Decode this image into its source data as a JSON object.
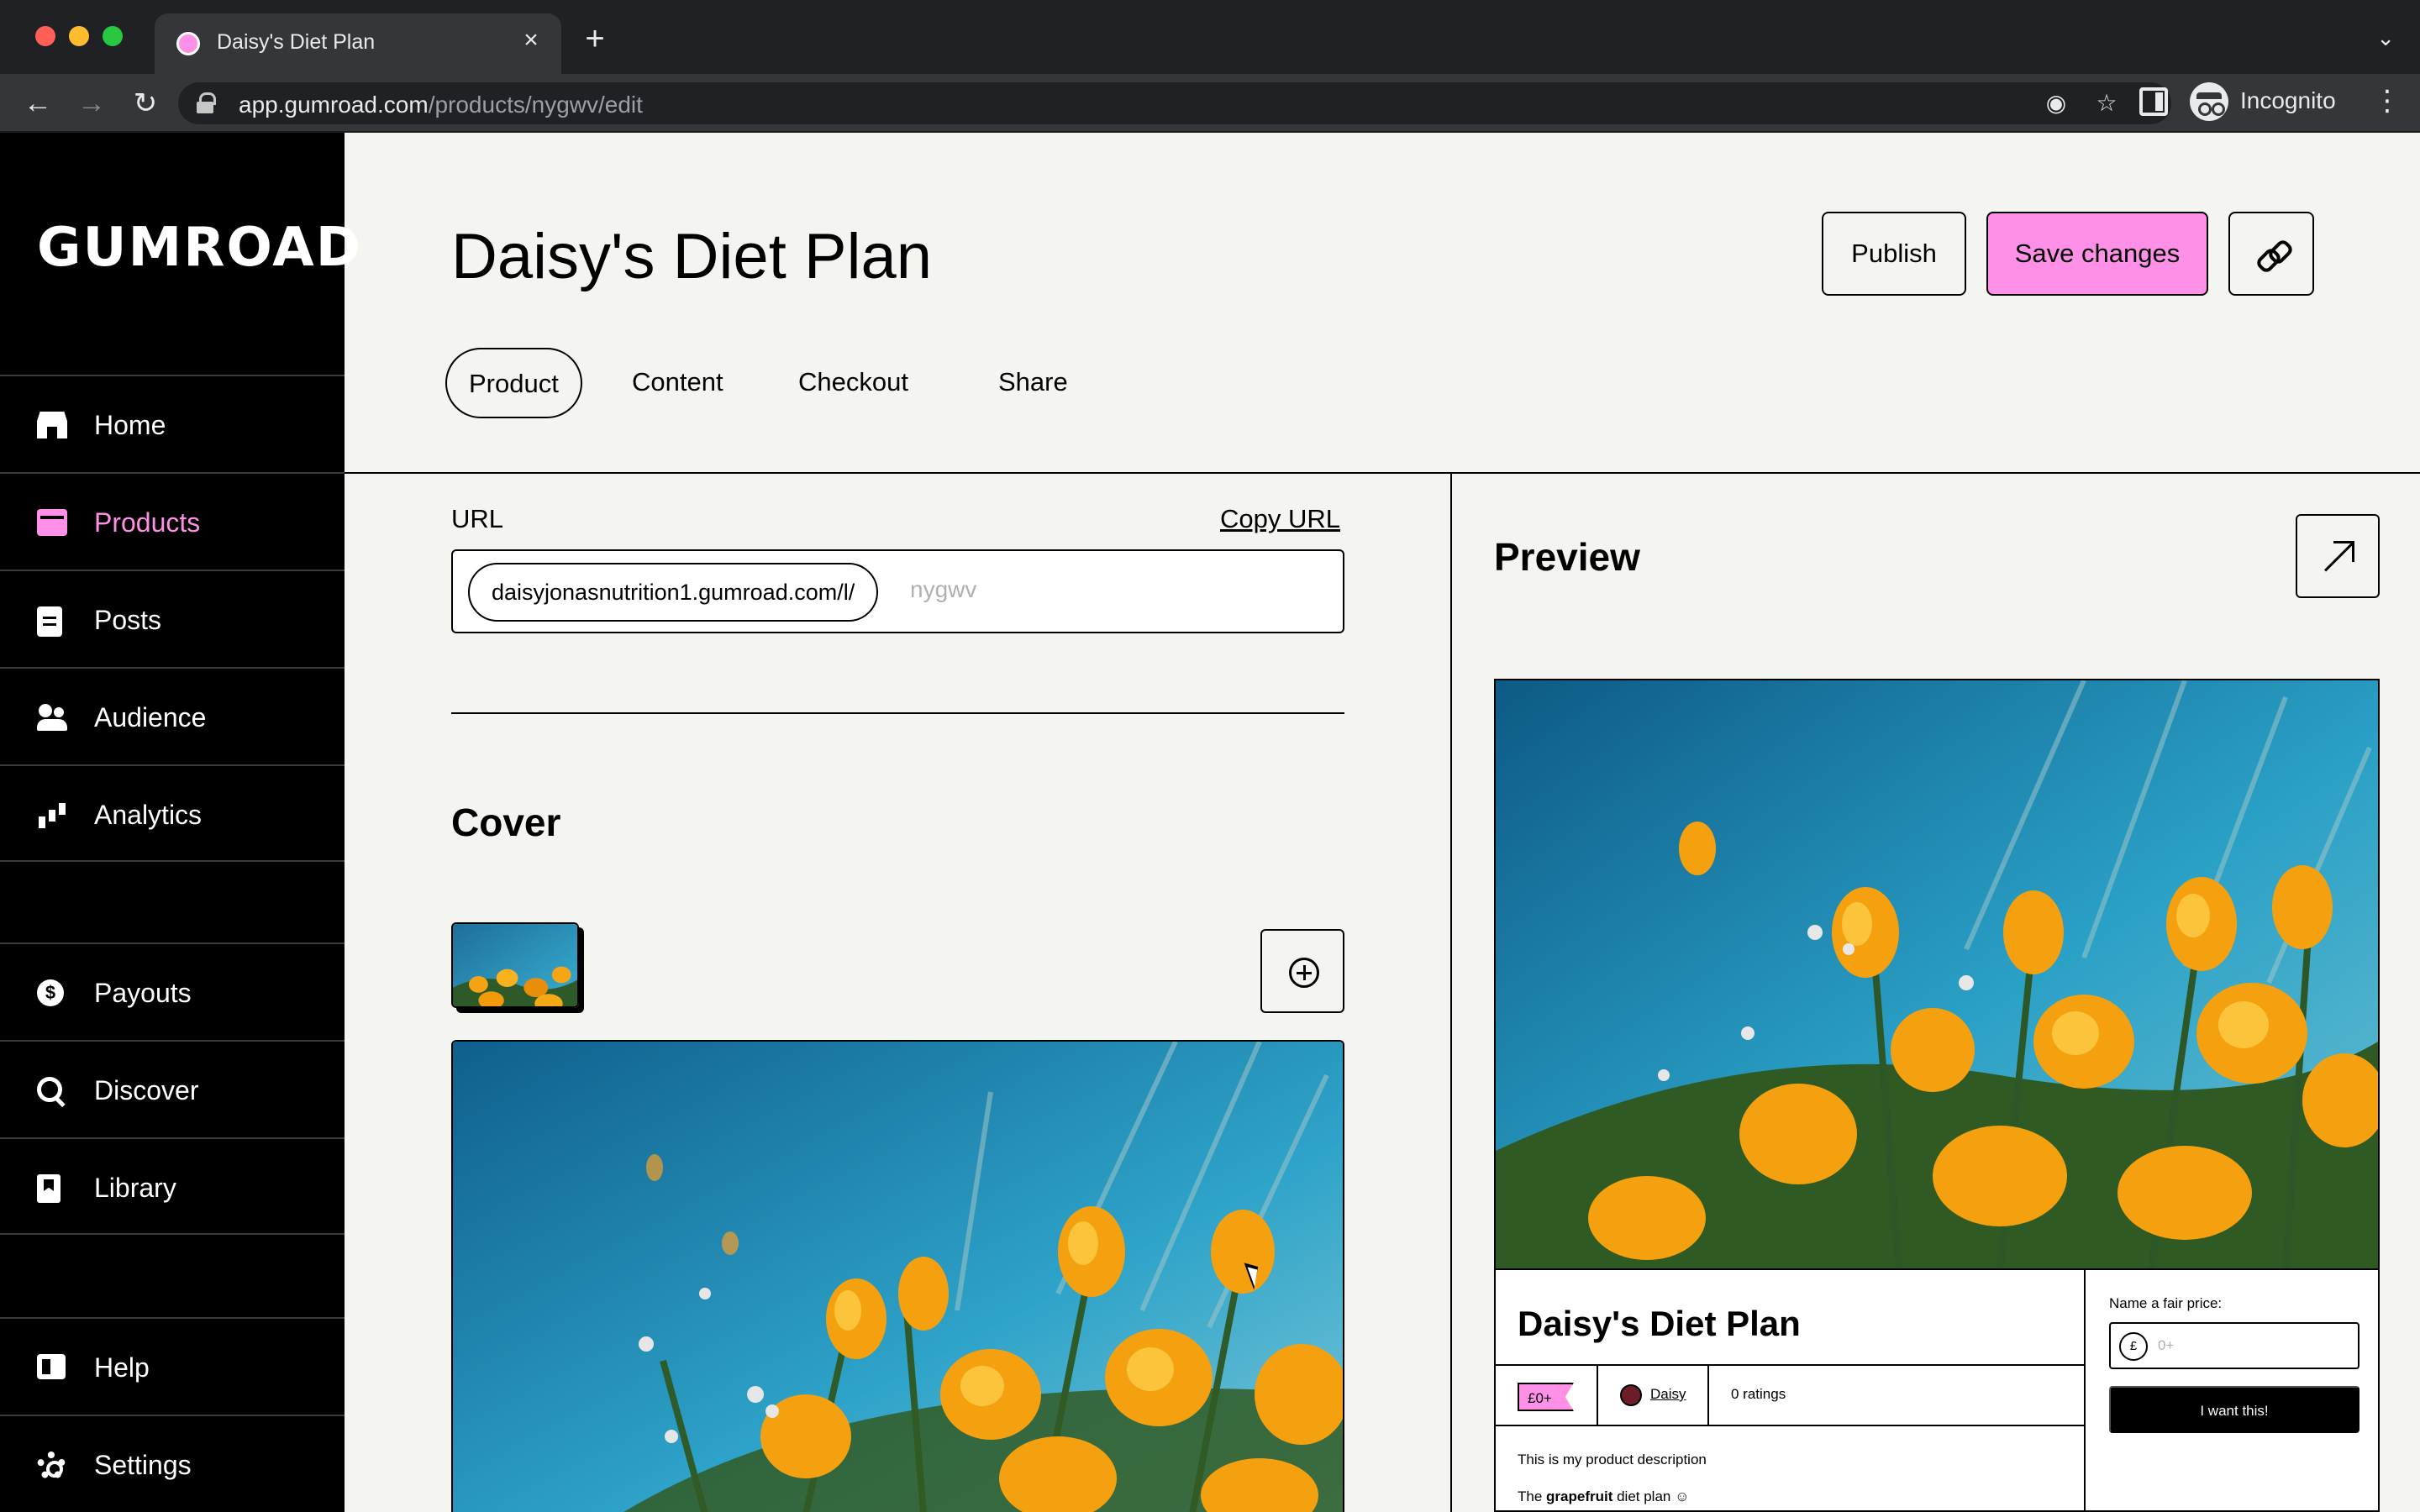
{
  "browser": {
    "tab_title": "Daisy's Diet Plan",
    "url_host": "app.gumroad.com",
    "url_path": "/products/nygwv/edit",
    "profile_label": "Incognito"
  },
  "sidebar": {
    "logo": "GUMROAD",
    "items": [
      {
        "label": "Home",
        "icon": "home-icon"
      },
      {
        "label": "Products",
        "icon": "products-icon",
        "active": true
      },
      {
        "label": "Posts",
        "icon": "posts-icon"
      },
      {
        "label": "Audience",
        "icon": "audience-icon"
      },
      {
        "label": "Analytics",
        "icon": "analytics-icon"
      },
      {
        "label": "Payouts",
        "icon": "payouts-icon"
      },
      {
        "label": "Discover",
        "icon": "discover-icon"
      },
      {
        "label": "Library",
        "icon": "library-icon"
      },
      {
        "label": "Help",
        "icon": "help-icon"
      },
      {
        "label": "Settings",
        "icon": "settings-icon"
      }
    ],
    "accent_color": "#ff90e8"
  },
  "header": {
    "title": "Daisy's Diet Plan",
    "publish_label": "Publish",
    "save_label": "Save changes"
  },
  "tabs": [
    {
      "label": "Product",
      "selected": true
    },
    {
      "label": "Content"
    },
    {
      "label": "Checkout"
    },
    {
      "label": "Share"
    }
  ],
  "editor": {
    "url_label": "URL",
    "copy_url_label": "Copy URL",
    "url_prefix": "daisyjonasnutrition1.gumroad.com/l/",
    "url_slug_placeholder": "nygwv",
    "cover_heading": "Cover"
  },
  "preview": {
    "heading": "Preview",
    "product_title": "Daisy's Diet Plan",
    "price_badge": "£0+",
    "creator": "Daisy",
    "ratings": "0 ratings",
    "description": "This is my product description",
    "desc_prefix": "The ",
    "desc_bold": "grapefruit",
    "desc_suffix": " diet plan ☺",
    "fair_price_label": "Name a fair price:",
    "currency_symbol": "£",
    "price_placeholder": "0+",
    "buy_label": "I want this!"
  }
}
